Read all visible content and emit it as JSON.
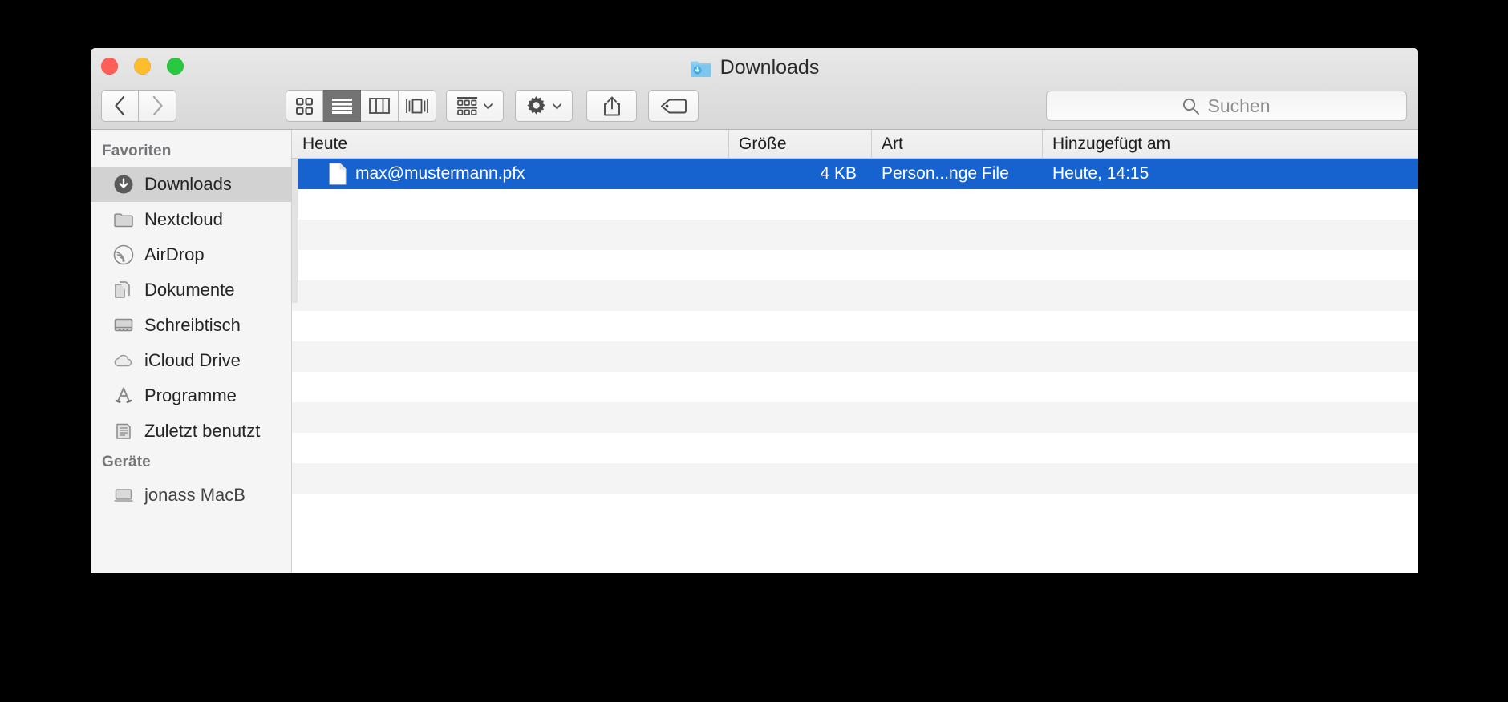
{
  "window": {
    "title": "Downloads",
    "folder_icon": "downloads-folder-icon",
    "traffic_lights": [
      {
        "name": "close",
        "color": "#ff5f57"
      },
      {
        "name": "minimize",
        "color": "#ffbd2e"
      },
      {
        "name": "zoom",
        "color": "#28c840"
      }
    ]
  },
  "toolbar": {
    "back_icon": "chevron-left-icon",
    "forward_icon": "chevron-right-icon",
    "views": [
      {
        "id": "icon",
        "icon": "grid-view-icon",
        "active": false
      },
      {
        "id": "list",
        "icon": "list-view-icon",
        "active": true
      },
      {
        "id": "column",
        "icon": "column-view-icon",
        "active": false
      },
      {
        "id": "cover",
        "icon": "coverflow-view-icon",
        "active": false
      }
    ],
    "arrange_icon": "arrange-by-icon",
    "arrange_chevron": "chevron-down-icon",
    "action_icon": "gear-icon",
    "action_chevron": "chevron-down-icon",
    "share_icon": "share-icon",
    "tag_icon": "tag-icon"
  },
  "search": {
    "icon": "search-icon",
    "placeholder": "Suchen",
    "value": ""
  },
  "sidebar": {
    "sections": [
      {
        "header": "Favoriten",
        "items": [
          {
            "label": "Downloads",
            "icon": "downloads-circle-icon",
            "selected": true
          },
          {
            "label": "Nextcloud",
            "icon": "folder-icon",
            "selected": false
          },
          {
            "label": "AirDrop",
            "icon": "airdrop-icon",
            "selected": false
          },
          {
            "label": "Dokumente",
            "icon": "documents-icon",
            "selected": false
          },
          {
            "label": "Schreibtisch",
            "icon": "desktop-icon",
            "selected": false
          },
          {
            "label": "iCloud Drive",
            "icon": "cloud-icon",
            "selected": false
          },
          {
            "label": "Programme",
            "icon": "applications-icon",
            "selected": false
          },
          {
            "label": "Zuletzt benutzt",
            "icon": "recents-icon",
            "selected": false
          }
        ]
      },
      {
        "header": "Geräte",
        "items": [
          {
            "label": "jonass MacB",
            "icon": "computer-icon",
            "selected": false,
            "clipped": true
          }
        ]
      }
    ]
  },
  "filelist": {
    "columns": [
      {
        "key": "name",
        "label": "Heute"
      },
      {
        "key": "size",
        "label": "Größe"
      },
      {
        "key": "kind",
        "label": "Art"
      },
      {
        "key": "date",
        "label": "Hinzugefügt am"
      }
    ],
    "rows": [
      {
        "icon": "document-icon",
        "name": "max@mustermann.pfx",
        "size": "4 KB",
        "kind": "Person...nge File",
        "date": "Heute, 14:15",
        "selected": true
      }
    ],
    "empty_row_count": 10,
    "selection_color": "#1663d0",
    "stripe_color": "#f4f4f4"
  }
}
